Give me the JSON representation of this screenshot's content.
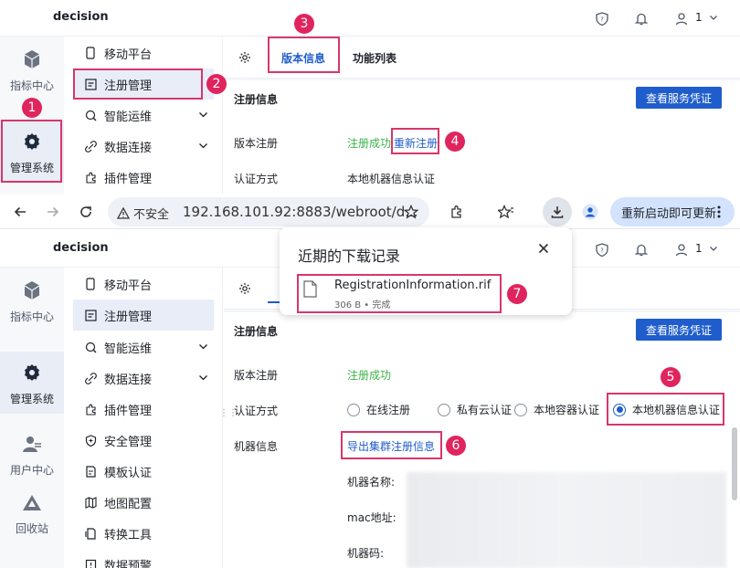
{
  "top_panel": {
    "brand": "decision",
    "user_count": "1",
    "rail": [
      {
        "label": "指标中心",
        "icon": "cube-icon"
      },
      {
        "label": "管理系统",
        "icon": "gear-icon"
      }
    ],
    "submenu": [
      {
        "label": "移动平台",
        "icon": "mobile-icon"
      },
      {
        "label": "注册管理",
        "icon": "register-icon"
      },
      {
        "label": "智能运维",
        "icon": "ops-icon"
      },
      {
        "label": "数据连接",
        "icon": "link-icon"
      },
      {
        "label": "插件管理",
        "icon": "plugin-icon"
      }
    ],
    "tabs": [
      "版本信息",
      "功能列表"
    ],
    "section_title": "注册信息",
    "view_cert_button": "查看服务凭证",
    "version_label": "版本注册",
    "version_status": "注册成功",
    "re_register_link": "重新注册",
    "auth_label": "认证方式",
    "auth_value": "本地机器信息认证"
  },
  "browser": {
    "insecure_label": "不安全",
    "url": "192.168.101.92:8883/webroot/d...",
    "update_button": "重新启动即可更新"
  },
  "downloads_popup": {
    "title": "近期的下载记录",
    "file_name": "RegistrationInformation.rif",
    "file_meta": "306 B • 完成"
  },
  "bottom_panel": {
    "brand": "decision",
    "user_count": "1",
    "rail": [
      {
        "label": "指标中心",
        "icon": "cube-icon"
      },
      {
        "label": "管理系统",
        "icon": "gear-icon"
      },
      {
        "label": "用户中心",
        "icon": "users-icon"
      },
      {
        "label": "回收站",
        "icon": "recycle-icon"
      }
    ],
    "submenu": [
      {
        "label": "移动平台",
        "icon": "mobile-icon"
      },
      {
        "label": "注册管理",
        "icon": "register-icon"
      },
      {
        "label": "智能运维",
        "icon": "ops-icon"
      },
      {
        "label": "数据连接",
        "icon": "link-icon"
      },
      {
        "label": "插件管理",
        "icon": "plugin-icon"
      },
      {
        "label": "安全管理",
        "icon": "shield-icon"
      },
      {
        "label": "模板认证",
        "icon": "template-icon"
      },
      {
        "label": "地图配置",
        "icon": "map-icon"
      },
      {
        "label": "转换工具",
        "icon": "convert-icon"
      },
      {
        "label": "数据预警",
        "icon": "alert-icon"
      }
    ],
    "section_title": "注册信息",
    "view_cert_button": "查看服务凭证",
    "version_label": "版本注册",
    "version_status": "注册成功",
    "auth_label": "认证方式",
    "auth_options": [
      {
        "label": "在线注册",
        "selected": false
      },
      {
        "label": "私有云认证",
        "selected": false
      },
      {
        "label": "本地容器认证",
        "selected": false
      },
      {
        "label": "本地机器信息认证",
        "selected": true
      }
    ],
    "machine_label": "机器信息",
    "export_link": "导出集群注册信息",
    "machine_fields": [
      "机器名称:",
      "mac地址:",
      "机器码:"
    ]
  },
  "markers": [
    "1",
    "2",
    "3",
    "4",
    "5",
    "6",
    "7"
  ],
  "colors": {
    "accent": "#1f5dcc",
    "success": "#3db34a",
    "highlight": "#d6376b",
    "marker": "#e0245e"
  }
}
